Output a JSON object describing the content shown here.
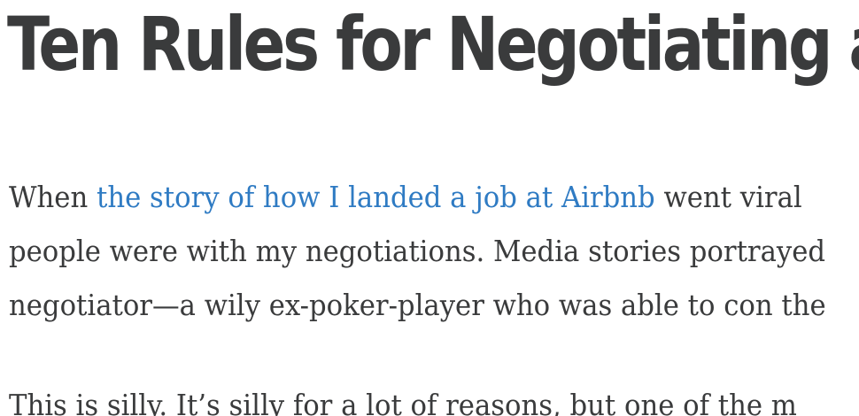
{
  "article": {
    "title": "Ten Rules for Negotiating a",
    "paragraph1": {
      "line1_before": "When ",
      "line1_link": "the story of how I landed a job at Airbnb",
      "line1_after": " went viral",
      "line2": "people were with my negotiations. Media stories portrayed",
      "line3": "negotiator—a wily ex-poker-player who was able to con the"
    },
    "paragraph2": {
      "line1": "This is silly. It’s silly for a lot of reasons, but one of the m"
    }
  },
  "colors": {
    "text": "#3a3b3c",
    "link": "#2f7bc3",
    "background": "#ffffff"
  }
}
